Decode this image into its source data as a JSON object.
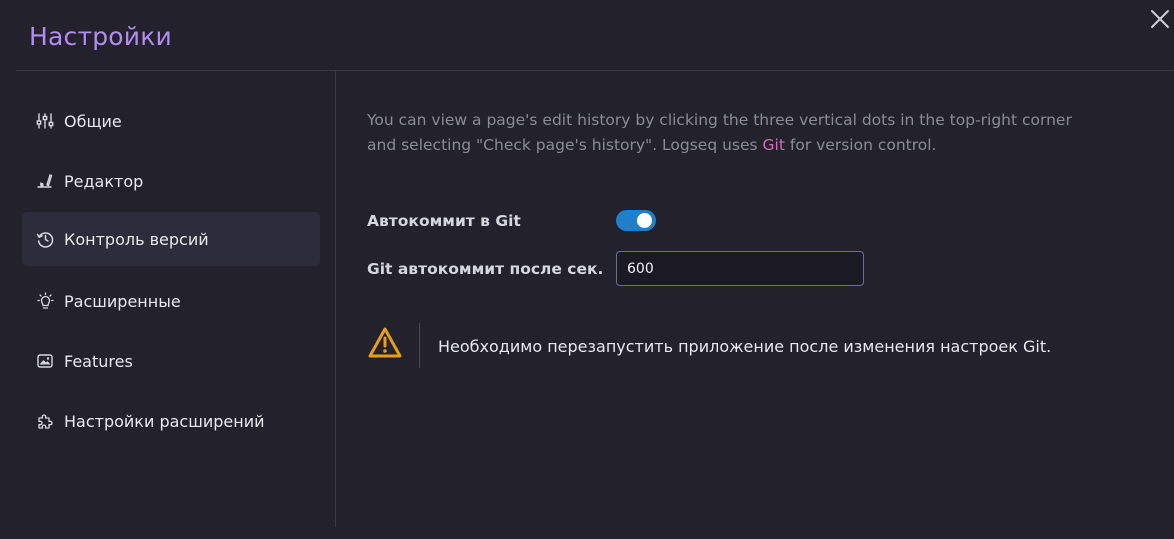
{
  "header": {
    "title": "Настройки",
    "close_icon": "close-icon"
  },
  "sidebar": {
    "items": [
      {
        "label": "Общие",
        "icon": "sliders-icon",
        "active": false
      },
      {
        "label": "Редактор",
        "icon": "writing-icon",
        "active": false
      },
      {
        "label": "Контроль версий",
        "icon": "history-icon",
        "active": true
      },
      {
        "label": "Расширенные",
        "icon": "bulb-icon",
        "active": false
      },
      {
        "label": "Features",
        "icon": "app-feature-icon",
        "active": false
      },
      {
        "label": "Настройки расширений",
        "icon": "puzzle-icon",
        "active": false
      }
    ]
  },
  "main": {
    "description_before_link": "You can view a page's edit history by clicking the three vertical dots in the top-right corner and selecting \"Check page's history\". Logseq uses ",
    "description_link": "Git",
    "description_after_link": " for version control.",
    "auto_commit_label": "Автокоммит в Git",
    "auto_commit_enabled": true,
    "auto_commit_secs_label": "Git автокоммит после сек.",
    "auto_commit_secs_value": "600",
    "warning_icon": "alert-triangle-icon",
    "warning_text": "Необходимо перезапустить приложение после изменения настроек Git."
  },
  "colors": {
    "accent_title": "#b48bef",
    "link": "#d86bb3",
    "toggle_on": "#1f80c9",
    "warning": "#e59e1c"
  }
}
